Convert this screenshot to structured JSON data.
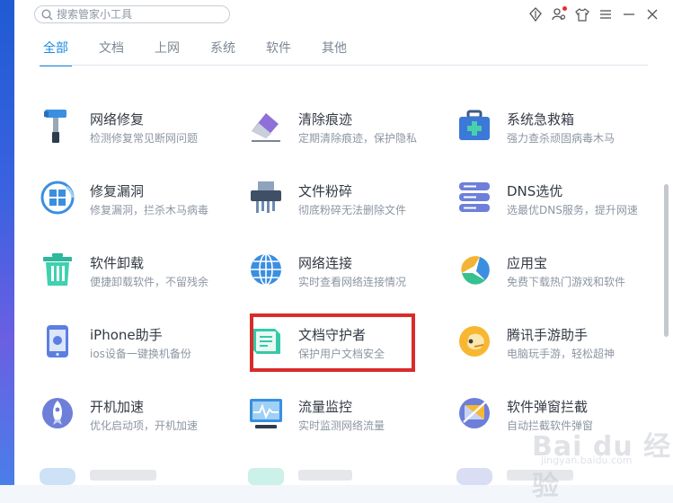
{
  "search": {
    "placeholder": "搜索管家小工具"
  },
  "tabs": [
    {
      "label": "全部",
      "active": true
    },
    {
      "label": "文档"
    },
    {
      "label": "上网"
    },
    {
      "label": "系统"
    },
    {
      "label": "软件"
    },
    {
      "label": "其他"
    }
  ],
  "tools": [
    {
      "name": "网络修复",
      "desc": "检测修复常见断网问题",
      "icon": "hammer-icon"
    },
    {
      "name": "清除痕迹",
      "desc": "定期清除痕迹，保护隐私",
      "icon": "eraser-icon"
    },
    {
      "name": "系统急救箱",
      "desc": "强力查杀顽固病毒木马",
      "icon": "first-aid-kit-icon"
    },
    {
      "name": "修复漏洞",
      "desc": "修复漏洞，拦杀木马病毒",
      "icon": "windows-repair-icon"
    },
    {
      "name": "文件粉碎",
      "desc": "彻底粉碎无法删除文件",
      "icon": "shredder-icon"
    },
    {
      "name": "DNS选优",
      "desc": "选最优DNS服务，提升网速",
      "icon": "server-icon"
    },
    {
      "name": "软件卸载",
      "desc": "便捷卸载软件，不留残余",
      "icon": "trash-icon"
    },
    {
      "name": "网络连接",
      "desc": "实时查看网络连接情况",
      "icon": "globe-icon"
    },
    {
      "name": "应用宝",
      "desc": "免费下载热门游戏和软件",
      "icon": "app-store-icon"
    },
    {
      "name": "iPhone助手",
      "desc": "ios设备一键换机备份",
      "icon": "iphone-icon"
    },
    {
      "name": "文档守护者",
      "desc": "保护用户文档安全",
      "icon": "document-guard-icon"
    },
    {
      "name": "腾讯手游助手",
      "desc": "电脑玩手游，轻松超神",
      "icon": "game-assistant-icon"
    },
    {
      "name": "开机加速",
      "desc": "优化启动项，开机加速",
      "icon": "rocket-icon"
    },
    {
      "name": "流量监控",
      "desc": "实时监测网络流量",
      "icon": "monitor-icon"
    },
    {
      "name": "软件弹窗拦截",
      "desc": "自动拦截软件弹窗",
      "icon": "popup-block-icon"
    }
  ],
  "watermark": {
    "text": "Bai du 经验",
    "sub": "jingyan.baidu.com"
  },
  "colors": {
    "accent": "#1b8be0",
    "highlight": "#d92b2b"
  }
}
